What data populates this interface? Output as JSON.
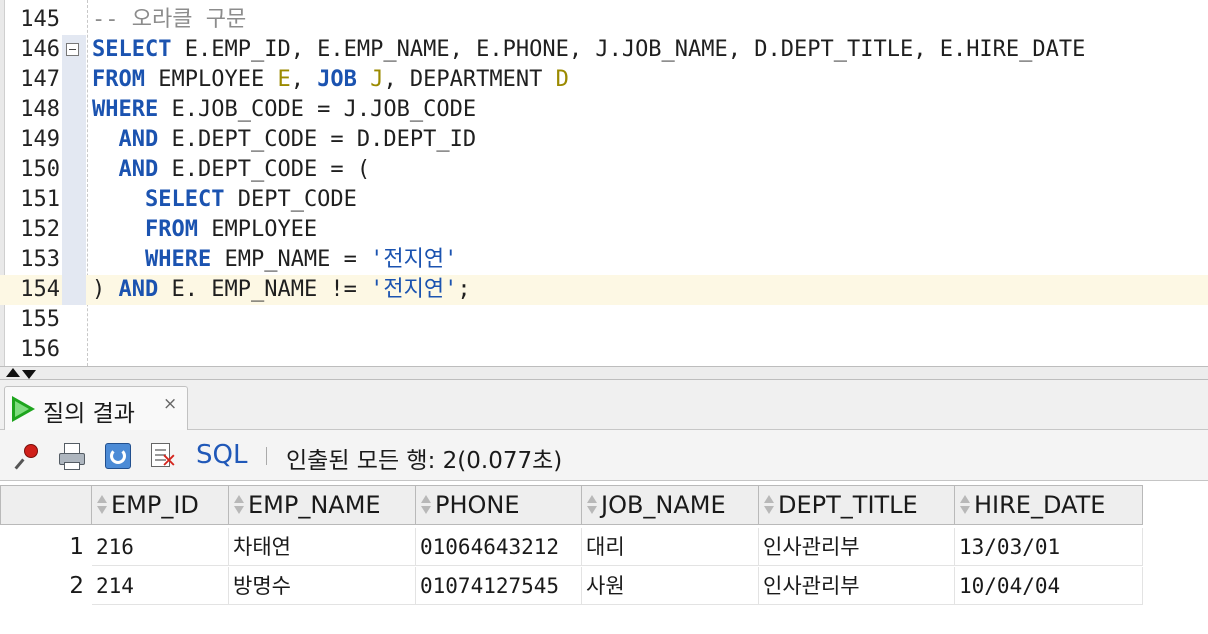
{
  "editor": {
    "lines": [
      {
        "no": "145",
        "tokens": [
          {
            "t": "-- 오라클 구문",
            "c": "cm"
          }
        ]
      },
      {
        "no": "146",
        "fold": true,
        "tokens": [
          {
            "t": "SELECT",
            "c": "kw"
          },
          {
            "t": " E.EMP_ID, E.EMP_NAME, E.PHONE, J.JOB_NAME, D.DEPT_TITLE, E.HIRE_DATE",
            "c": ""
          }
        ]
      },
      {
        "no": "147",
        "tokens": [
          {
            "t": "FROM",
            "c": "kw"
          },
          {
            "t": " EMPLOYEE ",
            "c": ""
          },
          {
            "t": "E",
            "c": "alias"
          },
          {
            "t": ", ",
            "c": ""
          },
          {
            "t": "JOB",
            "c": "kw"
          },
          {
            "t": " ",
            "c": ""
          },
          {
            "t": "J",
            "c": "alias"
          },
          {
            "t": ", DEPARTMENT ",
            "c": ""
          },
          {
            "t": "D",
            "c": "alias"
          }
        ]
      },
      {
        "no": "148",
        "tokens": [
          {
            "t": "WHERE",
            "c": "kw"
          },
          {
            "t": " E.JOB_CODE = J.JOB_CODE",
            "c": ""
          }
        ]
      },
      {
        "no": "149",
        "tokens": [
          {
            "t": "  ",
            "c": ""
          },
          {
            "t": "AND",
            "c": "kw"
          },
          {
            "t": " E.DEPT_CODE = D.DEPT_ID",
            "c": ""
          }
        ]
      },
      {
        "no": "150",
        "tokens": [
          {
            "t": "  ",
            "c": ""
          },
          {
            "t": "AND",
            "c": "kw"
          },
          {
            "t": " E.DEPT_CODE = (",
            "c": ""
          }
        ]
      },
      {
        "no": "151",
        "tokens": [
          {
            "t": "    ",
            "c": ""
          },
          {
            "t": "SELECT",
            "c": "kw"
          },
          {
            "t": " DEPT_CODE",
            "c": ""
          }
        ]
      },
      {
        "no": "152",
        "tokens": [
          {
            "t": "    ",
            "c": ""
          },
          {
            "t": "FROM",
            "c": "kw"
          },
          {
            "t": " EMPLOYEE",
            "c": ""
          }
        ]
      },
      {
        "no": "153",
        "tokens": [
          {
            "t": "    ",
            "c": ""
          },
          {
            "t": "WHERE",
            "c": "kw"
          },
          {
            "t": " EMP_NAME = ",
            "c": ""
          },
          {
            "t": "'전지연'",
            "c": "str"
          }
        ]
      },
      {
        "no": "154",
        "current": true,
        "tokens": [
          {
            "t": ") ",
            "c": ""
          },
          {
            "t": "AND",
            "c": "kw"
          },
          {
            "t": " E. EMP_NAME != ",
            "c": ""
          },
          {
            "t": "'전지연'",
            "c": "str"
          },
          {
            "t": ";",
            "c": ""
          }
        ]
      },
      {
        "no": "155",
        "tokens": []
      },
      {
        "no": "156",
        "tokens": []
      }
    ]
  },
  "results_tab": {
    "label": "질의 결과",
    "close": "×"
  },
  "toolbar": {
    "sql_label": "SQL",
    "status": "인출된 모든 행: 2(0.077초)",
    "icons": [
      "pin-icon",
      "print-icon",
      "refresh-icon",
      "cancel-icon"
    ]
  },
  "grid": {
    "columns": [
      "EMP_ID",
      "EMP_NAME",
      "PHONE",
      "JOB_NAME",
      "DEPT_TITLE",
      "HIRE_DATE"
    ],
    "rows": [
      {
        "num": "1",
        "cells": [
          "216",
          "차태연",
          "01064643212",
          "대리",
          "인사관리부",
          "13/03/01"
        ]
      },
      {
        "num": "2",
        "cells": [
          "214",
          "방명수",
          "01074127545",
          "사원",
          "인사관리부",
          "10/04/04"
        ]
      }
    ]
  },
  "colors": {
    "keyword": "#1b53b0",
    "alias": "#9b8a00",
    "comment": "#8c8c8c",
    "current_line": "#fdf8e4"
  }
}
